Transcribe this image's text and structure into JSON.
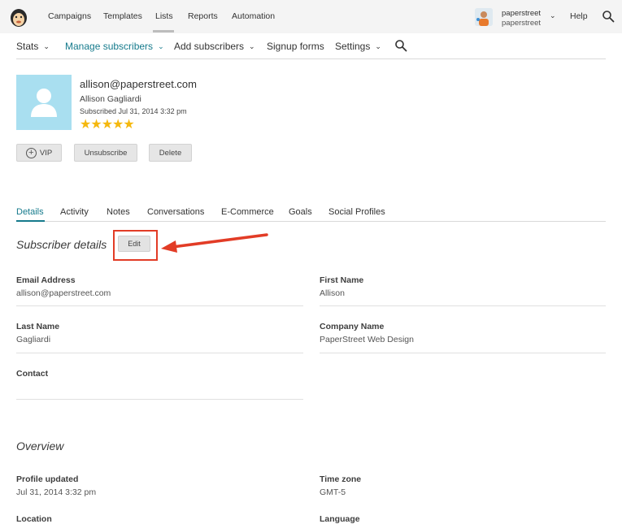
{
  "topnav": {
    "items": [
      "Campaigns",
      "Templates",
      "Lists",
      "Reports",
      "Automation"
    ],
    "active": "Lists",
    "account_name": "paperstreet",
    "account_sub": "paperstreet",
    "help": "Help"
  },
  "subnav": {
    "stats": "Stats",
    "manage": "Manage subscribers",
    "add": "Add subscribers",
    "signup": "Signup forms",
    "settings": "Settings"
  },
  "profile": {
    "email": "allison@paperstreet.com",
    "name": "Allison Gagliardi",
    "subscribed": "Subscribed Jul 31, 2014 3:32 pm",
    "rating_stars": 5,
    "buttons": {
      "vip": "VIP",
      "unsubscribe": "Unsubscribe",
      "delete": "Delete"
    }
  },
  "tabs": [
    "Details",
    "Activity",
    "Notes",
    "Conversations",
    "E-Commerce",
    "Goals",
    "Social Profiles"
  ],
  "active_tab": "Details",
  "details": {
    "title": "Subscriber details",
    "edit_label": "Edit",
    "fields": [
      {
        "label": "Email Address",
        "value": "allison@paperstreet.com"
      },
      {
        "label": "First Name",
        "value": "Allison"
      },
      {
        "label": "Last Name",
        "value": "Gagliardi"
      },
      {
        "label": "Company Name",
        "value": "PaperStreet Web Design"
      },
      {
        "label": "Contact",
        "value": ""
      }
    ]
  },
  "overview": {
    "title": "Overview",
    "fields": [
      {
        "label": "Profile updated",
        "value": "Jul 31, 2014 3:32 pm"
      },
      {
        "label": "Time zone",
        "value": "GMT-5"
      },
      {
        "label": "Location",
        "value": ""
      },
      {
        "label": "Language",
        "value": ""
      }
    ]
  },
  "colors": {
    "accent": "#157a8c",
    "avatar_bg": "#a9dff0",
    "star": "#f5b80e",
    "annotation": "#e23c26"
  },
  "icons": {
    "logo": "mailchimp-freddie-icon",
    "search": "search-icon",
    "avatar": "user-silhouette-icon",
    "vip": "plus-circle-icon",
    "chevron": "chevron-down-icon"
  }
}
